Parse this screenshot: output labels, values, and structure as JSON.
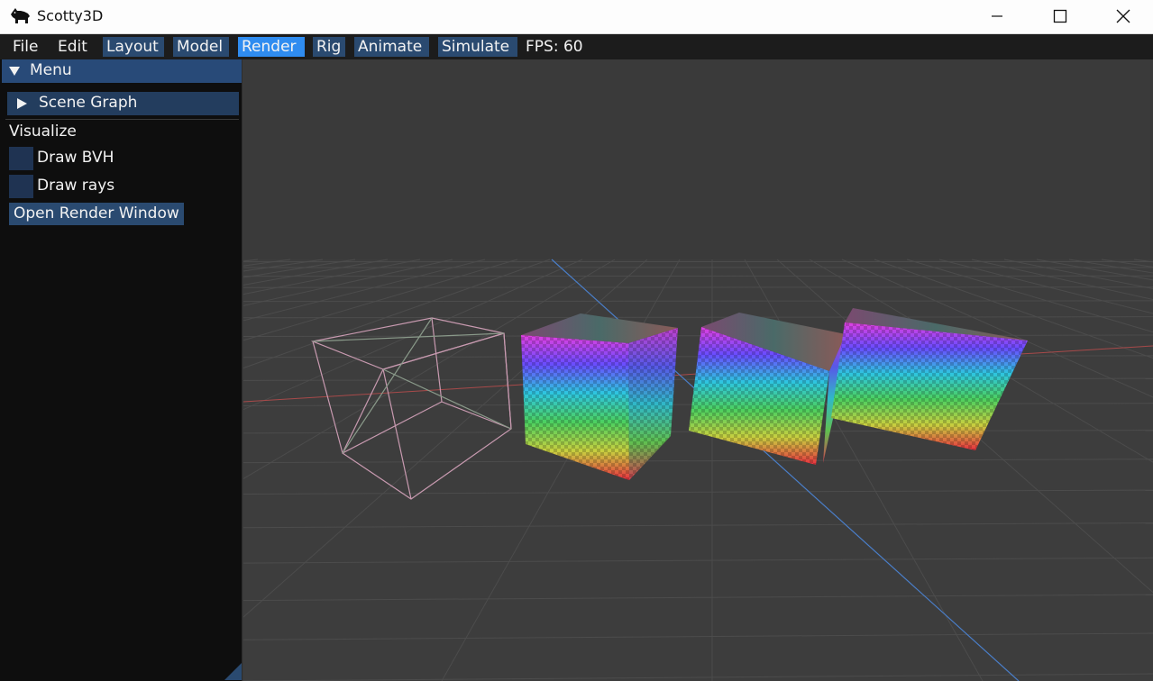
{
  "window": {
    "title": "Scotty3D",
    "app_icon": "scottie-dog-icon",
    "controls": [
      "minimize-icon",
      "maximize-icon",
      "close-icon"
    ]
  },
  "menubar": {
    "file": "File",
    "edit": "Edit",
    "tabs": {
      "layout": "Layout",
      "model": "Model",
      "render": "Render",
      "rig": "Rig",
      "animate": "Animate",
      "simulate": "Simulate"
    },
    "active_tab": "Render",
    "fps": "FPS: 60"
  },
  "panel": {
    "header": "Menu",
    "scene_graph": "Scene Graph",
    "visualize_label": "Visualize",
    "draw_bvh": {
      "label": "Draw BVH",
      "checked": false
    },
    "draw_rays": {
      "label": "Draw rays",
      "checked": false
    },
    "open_render_window": "Open Render Window"
  },
  "colors": {
    "menubar_bg": "#1c1c1c",
    "tab_bg": "#2a4a70",
    "active_tab_bg": "#2f8cf0",
    "panel_bg": "#0e0e0e",
    "viewport_bg": "#3a3a3a",
    "x_axis": "#b04848",
    "z_axis": "#4a7fc8",
    "wireframe": "#c89ab0"
  },
  "viewport": {
    "objects": [
      "wireframe-cube",
      "textured-cube-1",
      "textured-cube-2",
      "textured-cube-3"
    ]
  }
}
